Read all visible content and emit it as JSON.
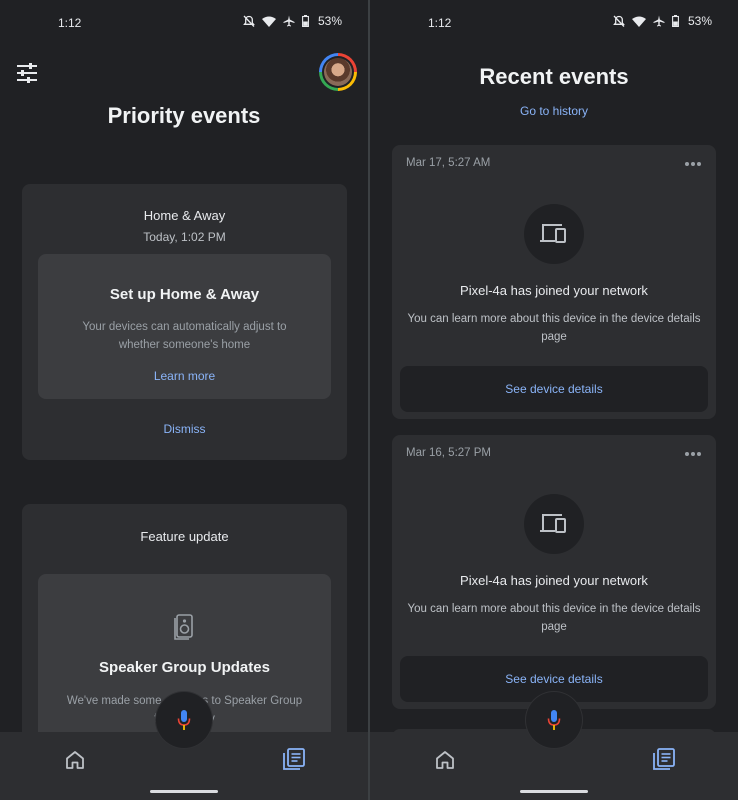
{
  "status_bar": {
    "time": "1:12",
    "battery": "53%"
  },
  "left": {
    "title": "Priority events",
    "home_card": {
      "title": "Home & Away",
      "time": "Today, 1:02 PM",
      "inner_title": "Set up Home & Away",
      "inner_body": "Your devices can automatically adjust to whether someone's home",
      "learn_more": "Learn more",
      "dismiss": "Dismiss"
    },
    "feature_card": {
      "title": "Feature update",
      "inner_title": "Speaker Group Updates",
      "inner_body": "We've made some changes to Speaker Group functionality"
    }
  },
  "right": {
    "title": "Recent events",
    "history_link": "Go to history",
    "events": [
      {
        "date": "Mar 17, 5:27 AM",
        "title": "Pixel-4a has joined your network",
        "body": "You can learn more about this device in the device details page",
        "button": "See device details"
      },
      {
        "date": "Mar 16, 5:27 PM",
        "title": "Pixel-4a has joined your network",
        "body": "You can learn more about this device in the device details page",
        "button": "See device details"
      }
    ]
  },
  "icons": {
    "tune": "tune-icon",
    "avatar": "avatar",
    "device": "devices-icon",
    "speaker": "speaker-icon",
    "home": "home-icon",
    "feed": "feed-icon",
    "mic": "mic-icon",
    "more": "more-horiz-icon"
  },
  "colors": {
    "background": "#202124",
    "card": "#2d2e31",
    "inner_card": "#3c3d40",
    "link": "#8ab4f8",
    "active_nav": "#8ab4f8"
  }
}
